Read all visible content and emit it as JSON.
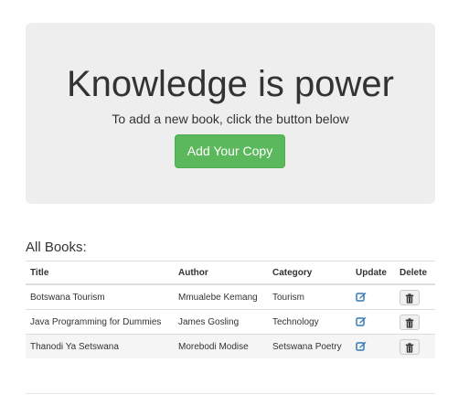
{
  "jumbotron": {
    "title": "Knowledge is power",
    "subtitle": "To add a new book, click the button below",
    "button_label": "Add Your Copy"
  },
  "books_section": {
    "title": "All Books:",
    "columns": {
      "title": "Title",
      "author": "Author",
      "category": "Category",
      "update": "Update",
      "delete": "Delete"
    },
    "rows": [
      {
        "title": "Botswana Tourism",
        "author": "Mmualebe Kemang",
        "category": "Tourism",
        "update_icon": "edit-icon",
        "delete_icon": "trash-icon"
      },
      {
        "title": "Java Programming for Dummies",
        "author": "James Gosling",
        "category": "Technology",
        "update_icon": "edit-icon",
        "delete_icon": "trash-icon"
      },
      {
        "title": "Thanodi Ya Setswana",
        "author": "Morebodi Modise",
        "category": "Setswana Poetry",
        "update_icon": "edit-icon",
        "delete_icon": "trash-icon"
      }
    ]
  },
  "colors": {
    "jumbotron_bg": "#eeeeee",
    "primary_button": "#5cb85c",
    "link_icon": "#337ab7",
    "border": "#dddddd"
  }
}
